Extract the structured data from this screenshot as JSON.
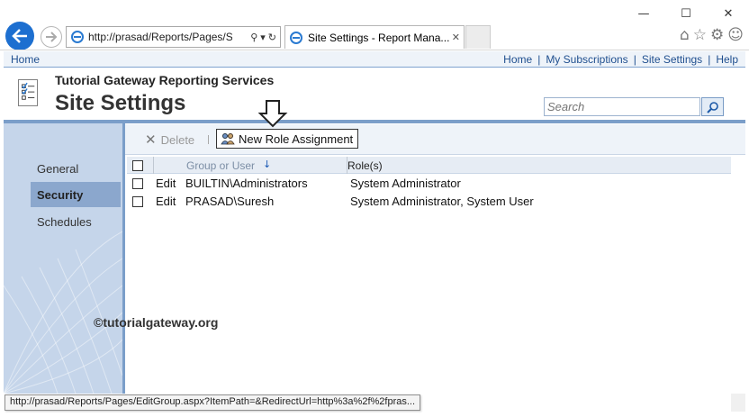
{
  "browser": {
    "address": "http://prasad/Reports/Pages/S",
    "tab_title": "Site Settings - Report Mana...",
    "status_url": "http://prasad/Reports/Pages/EditGroup.aspx?ItemPath=&RedirectUrl=http%3a%2f%2fpras..."
  },
  "topbar": {
    "home_left": "Home",
    "links": [
      "Home",
      "My Subscriptions",
      "Site Settings",
      "Help"
    ]
  },
  "header": {
    "brand": "Tutorial Gateway Reporting Services",
    "title": "Site Settings",
    "search_placeholder": "Search"
  },
  "nav": {
    "items": [
      {
        "label": "General"
      },
      {
        "label": "Security"
      },
      {
        "label": "Schedules"
      }
    ]
  },
  "toolbar": {
    "delete_label": "Delete",
    "new_role_label": "New Role Assignment"
  },
  "table": {
    "headers": {
      "group": "Group or User",
      "roles": "Role(s)"
    },
    "rows": [
      {
        "action": "Edit",
        "group": "BUILTIN\\Administrators",
        "roles": "System Administrator"
      },
      {
        "action": "Edit",
        "group": "PRASAD\\Suresh",
        "roles": "System Administrator, System User"
      }
    ]
  },
  "watermark": "©tutorialgateway.org",
  "colors": {
    "accent": "#1d6fd0",
    "nav_bg": "#c5d5ea",
    "nav_selected": "#8ba7cd",
    "rule": "#7b9ec9",
    "link": "#1f4f8f"
  }
}
